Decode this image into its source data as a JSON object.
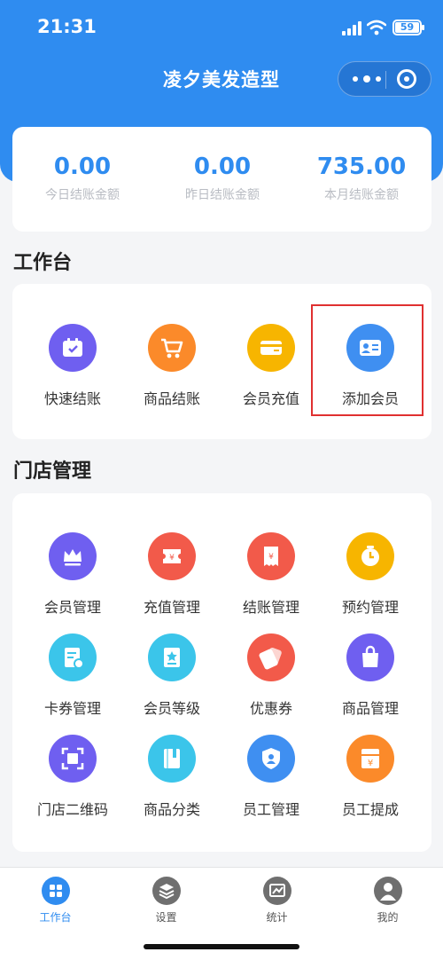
{
  "status_bar": {
    "time": "21:31",
    "battery": "59"
  },
  "nav": {
    "title": "凌夕美发造型"
  },
  "stats": [
    {
      "value": "0.00",
      "label": "今日结账金额"
    },
    {
      "value": "0.00",
      "label": "昨日结账金额"
    },
    {
      "value": "735.00",
      "label": "本月结账金额"
    }
  ],
  "workbench": {
    "title": "工作台",
    "items": [
      {
        "label": "快速结账",
        "icon": "calendar-check-icon",
        "color": "#6f5ff0"
      },
      {
        "label": "商品结账",
        "icon": "cart-icon",
        "color": "#fb8a2a"
      },
      {
        "label": "会员充值",
        "icon": "card-icon",
        "color": "#f7b500"
      },
      {
        "label": "添加会员",
        "icon": "id-card-icon",
        "color": "#3f8ff1"
      }
    ]
  },
  "store": {
    "title": "门店管理",
    "items": [
      {
        "label": "会员管理",
        "icon": "crown-icon",
        "color": "#6f5ff0"
      },
      {
        "label": "充值管理",
        "icon": "ticket-icon",
        "color": "#f25a4a"
      },
      {
        "label": "结账管理",
        "icon": "receipt-icon",
        "color": "#f25a4a"
      },
      {
        "label": "预约管理",
        "icon": "clock-icon",
        "color": "#f7b500"
      },
      {
        "label": "卡券管理",
        "icon": "document-icon",
        "color": "#3bc5ea"
      },
      {
        "label": "会员等级",
        "icon": "badge-icon",
        "color": "#3bc5ea"
      },
      {
        "label": "优惠券",
        "icon": "coupon-icon",
        "color": "#f25a4a"
      },
      {
        "label": "商品管理",
        "icon": "bag-icon",
        "color": "#6f5ff0"
      },
      {
        "label": "门店二维码",
        "icon": "qr-scan-icon",
        "color": "#6f5ff0"
      },
      {
        "label": "商品分类",
        "icon": "book-icon",
        "color": "#3bc5ea"
      },
      {
        "label": "员工管理",
        "icon": "shield-user-icon",
        "color": "#3f8ff1"
      },
      {
        "label": "员工提成",
        "icon": "money-box-icon",
        "color": "#fb8a2a"
      }
    ]
  },
  "tabbar": {
    "items": [
      {
        "label": "工作台",
        "icon": "grid-icon",
        "active": true
      },
      {
        "label": "设置",
        "icon": "layers-icon",
        "active": false
      },
      {
        "label": "统计",
        "icon": "chart-icon",
        "active": false
      },
      {
        "label": "我的",
        "icon": "user-icon",
        "active": false
      }
    ]
  }
}
